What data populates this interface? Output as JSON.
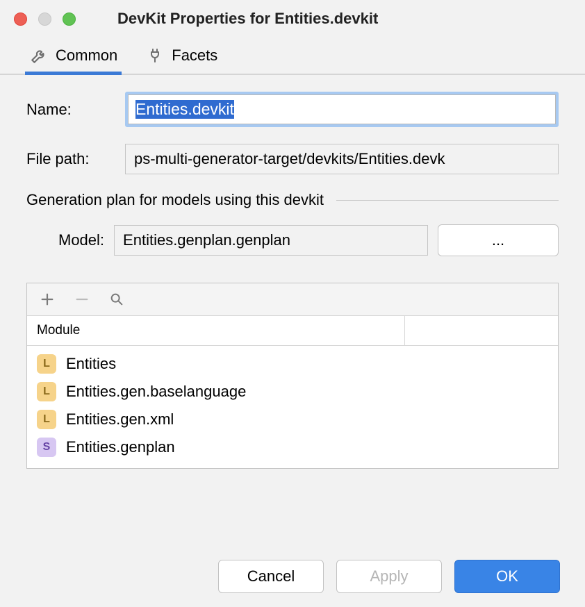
{
  "window": {
    "title": "DevKit Properties for Entities.devkit"
  },
  "tabs": {
    "common": "Common",
    "facets": "Facets"
  },
  "form": {
    "name_label": "Name:",
    "name_value": "Entities.devkit",
    "filepath_label": "File path:",
    "filepath_value": "ps-multi-generator-target/devkits/Entities.devk"
  },
  "genplan": {
    "section_title": "Generation plan for models using this devkit",
    "model_label": "Model:",
    "model_value": "Entities.genplan.genplan",
    "browse_label": "..."
  },
  "modules": {
    "header": "Module",
    "items": [
      {
        "badge": "L",
        "name": "Entities"
      },
      {
        "badge": "L",
        "name": "Entities.gen.baselanguage"
      },
      {
        "badge": "L",
        "name": "Entities.gen.xml"
      },
      {
        "badge": "S",
        "name": "Entities.genplan"
      }
    ]
  },
  "footer": {
    "cancel": "Cancel",
    "apply": "Apply",
    "ok": "OK"
  }
}
